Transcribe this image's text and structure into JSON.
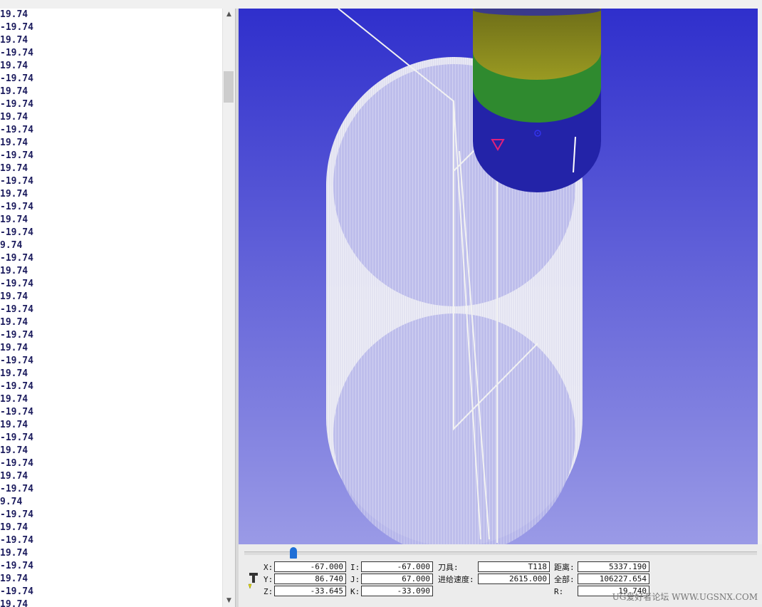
{
  "code_lines": [
    "19.74",
    "-19.74",
    "19.74",
    "-19.74",
    "19.74",
    "-19.74",
    "19.74",
    "-19.74",
    "19.74",
    "-19.74",
    "19.74",
    "-19.74",
    "19.74",
    "-19.74",
    "19.74",
    "-19.74",
    "19.74",
    "-19.74",
    "9.74",
    "-19.74",
    "19.74",
    "-19.74",
    "19.74",
    "-19.74",
    "19.74",
    "-19.74",
    "19.74",
    "-19.74",
    "19.74",
    "-19.74",
    "19.74",
    "-19.74",
    "19.74",
    "-19.74",
    "19.74",
    "-19.74",
    "19.74",
    "-19.74",
    "9.74",
    "-19.74",
    "19.74",
    "-19.74",
    "19.74",
    "-19.74",
    "19.74",
    "-19.74",
    "19.74"
  ],
  "scrollbar": {
    "up_arrow": "▲",
    "down_arrow": "▼"
  },
  "status": {
    "x_label": "X:",
    "x_value": "-67.000",
    "y_label": "Y:",
    "y_value": "86.740",
    "z_label": "Z:",
    "z_value": "-33.645",
    "i_label": "I:",
    "i_value": "-67.000",
    "j_label": "J:",
    "j_value": "67.000",
    "k_label": "K:",
    "k_value": "-33.090",
    "tool_label": "刀具:",
    "tool_value": "T118",
    "feed_label": "进给速度:",
    "feed_value": "2615.000",
    "dist_label": "距离:",
    "dist_value": "5337.190",
    "total_label": "全部:",
    "total_value": "106227.654",
    "r_label": "R:",
    "r_value": "19.740"
  },
  "watermark": "UG爱好者论坛 WWW.UGSNX.COM",
  "colors": {
    "viewport_top": "#2f2fcc",
    "viewport_bottom": "#9a9ae6",
    "toolpath": "#ffffff",
    "tool_shank": "#8a8a1e",
    "tool_band": "#2f8a2f",
    "tool_body": "#2323a8",
    "marker": "#e0207a"
  },
  "icons": {
    "tool": "tool-icon",
    "scroll_up": "scroll-up-icon",
    "scroll_down": "scroll-down-icon",
    "tool_position": "tool-position-marker-icon",
    "tool_center": "tool-center-icon"
  }
}
